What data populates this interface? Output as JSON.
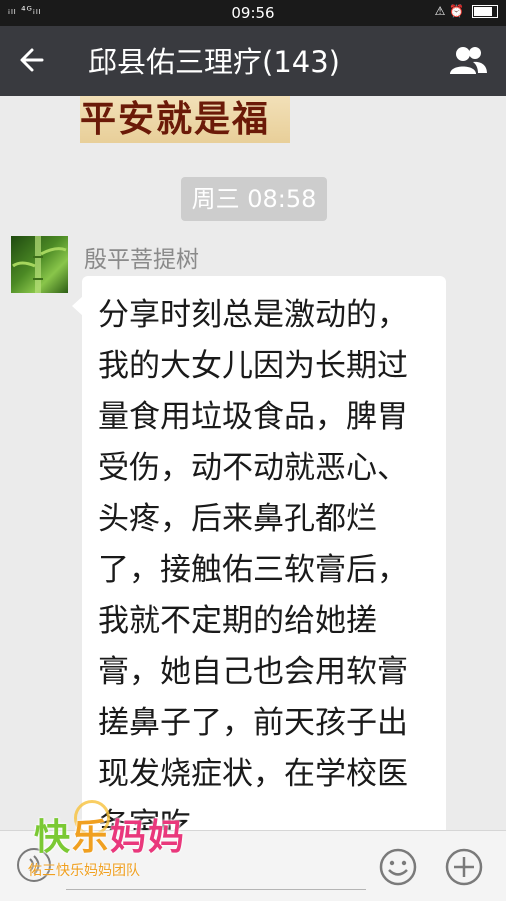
{
  "status_bar": {
    "signal_text": "ᵢₗₗ ⁴ᴳᵢₗₗ",
    "time": "09:56",
    "right_icons_text": "⚠ ⏰"
  },
  "header": {
    "back_icon": "arrow-left-icon",
    "title": "邱县佑三理疗(143)",
    "members_icon": "group-members-icon"
  },
  "banner": {
    "text": "平安就是福"
  },
  "timestamp": "周三 08:58",
  "message": {
    "sender": "殷平菩提树",
    "text": "分享时刻总是激动的，我的大女儿因为长期过量食用垃圾食品，脾胃受伤，动不动就恶心、头疼，后来鼻孔都烂了，接触佑三软膏后，我就不定期的给她搓膏，她自己也会用软膏搓鼻子了，前天孩子出现发烧症状，在学校医务室吃"
  },
  "input_bar": {
    "voice_icon": "voice-icon",
    "emoji_icon": "emoji-icon",
    "more_icon": "plus-circle-icon"
  },
  "watermark": {
    "big_text_1": "快",
    "big_text_2": "乐",
    "big_text_3": "妈妈",
    "small_text": "佑三快乐妈妈团队"
  },
  "colors": {
    "titlebar": "#393a3f",
    "chat_bg": "#ebebeb",
    "bubble": "#ffffff",
    "timestamp_bg": "#cdcdcd"
  }
}
